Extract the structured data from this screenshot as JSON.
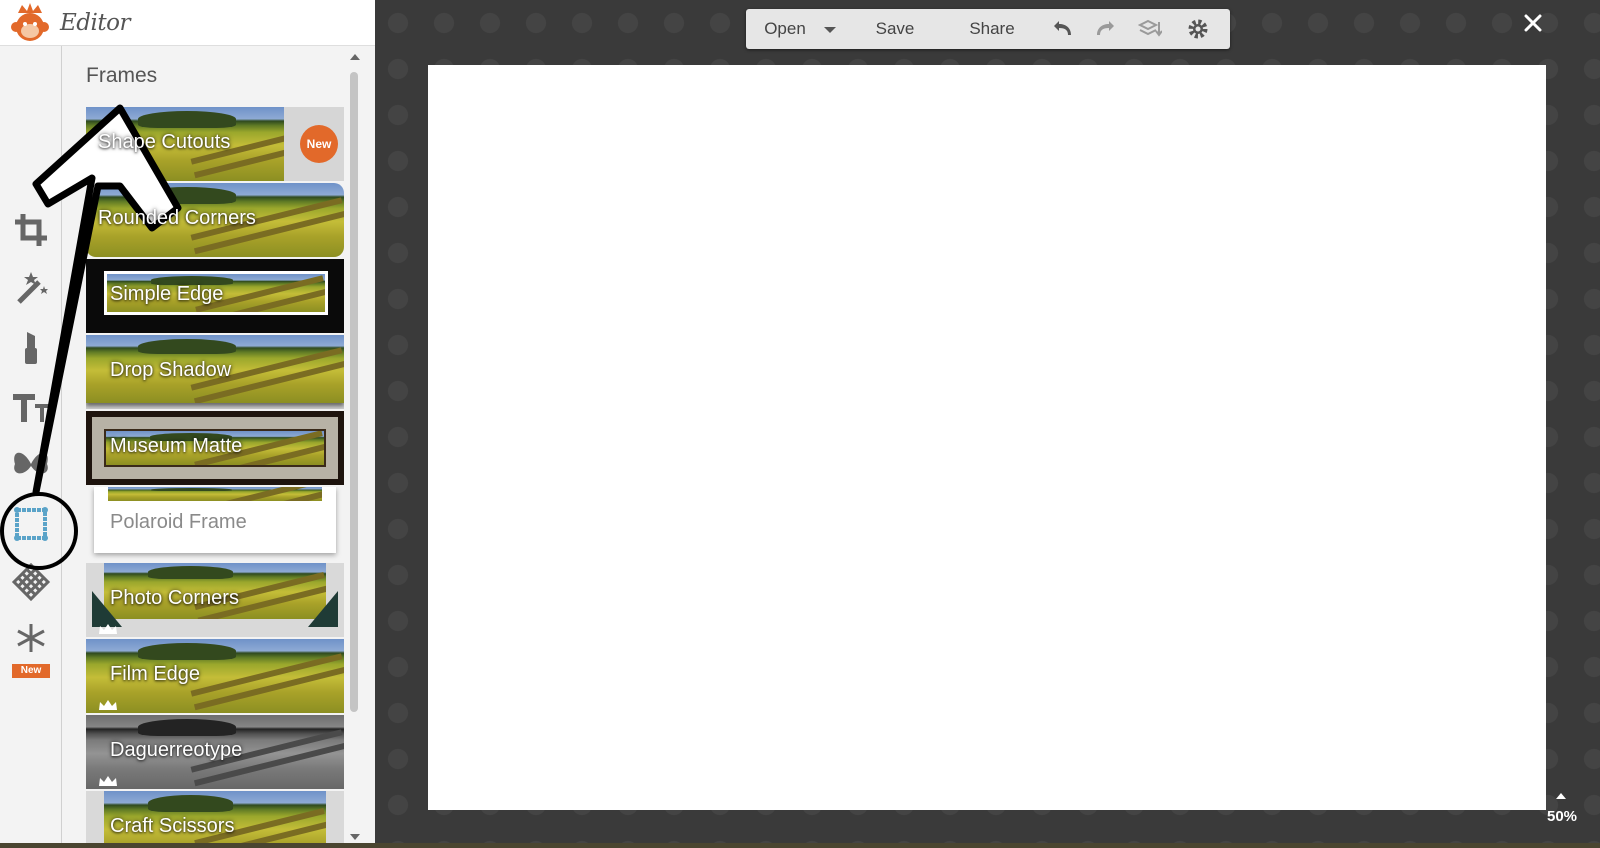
{
  "app": {
    "title": "Editor",
    "logo_icon": "monkey-logo-icon"
  },
  "rail": {
    "items": [
      {
        "name": "crop",
        "icon": "crop-icon"
      },
      {
        "name": "effects",
        "icon": "magic-wand-icon"
      },
      {
        "name": "touch-up",
        "icon": "lipstick-icon"
      },
      {
        "name": "text",
        "icon": "text-icon"
      },
      {
        "name": "overlays",
        "icon": "butterfly-icon"
      },
      {
        "name": "frames",
        "icon": "frame-icon",
        "active": true
      },
      {
        "name": "textures",
        "icon": "texture-icon"
      },
      {
        "name": "seasonal",
        "icon": "snowflake-icon"
      }
    ],
    "new_badge": "New"
  },
  "frames": {
    "heading": "Frames",
    "items": [
      {
        "label": "Shape Cutouts",
        "badge": "New"
      },
      {
        "label": "Rounded Corners"
      },
      {
        "label": "Simple Edge"
      },
      {
        "label": "Drop Shadow"
      },
      {
        "label": "Museum Matte"
      },
      {
        "label": "Polaroid Frame"
      },
      {
        "label": "Photo Corners",
        "premium": true
      },
      {
        "label": "Film Edge",
        "premium": true
      },
      {
        "label": "Daguerreotype",
        "premium": true
      },
      {
        "label": "Craft Scissors",
        "premium": true
      }
    ]
  },
  "toolbar": {
    "open_label": "Open",
    "save_label": "Save",
    "share_label": "Share"
  },
  "zoom": {
    "level": "50%"
  },
  "colors": {
    "accent": "#e2692a",
    "frame_icon_active": "#5aa3c8",
    "workspace": "#3a3a3a",
    "panel": "#f3f3f3"
  }
}
